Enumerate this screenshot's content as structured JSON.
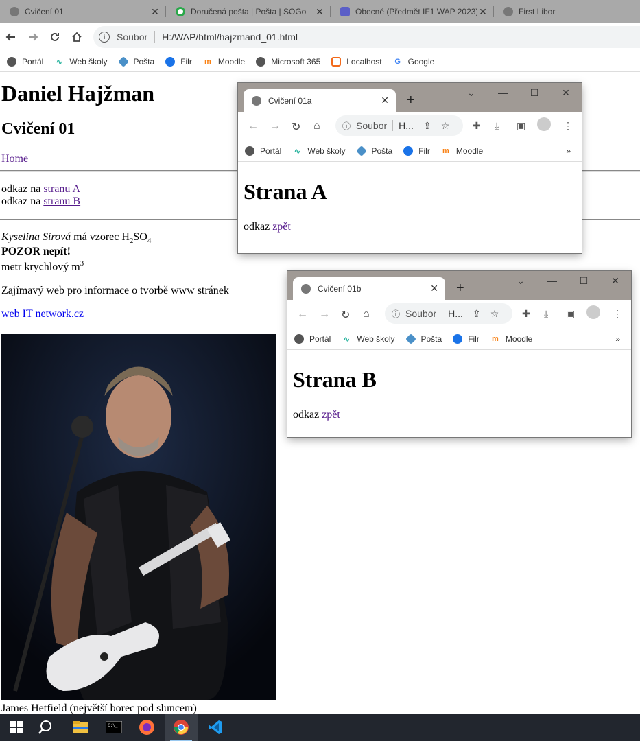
{
  "tabs": [
    {
      "label": "Cvičení 01",
      "icon": "globe-icon"
    },
    {
      "label": "Doručená pošta | Pošta | SOGo",
      "icon": "sogo-icon"
    },
    {
      "label": "Obecné (Předmět IF1 WAP 2023)",
      "icon": "teams-icon"
    },
    {
      "label": "First Libor",
      "icon": "globe-icon"
    }
  ],
  "toolbar": {
    "secure_label": "Soubor",
    "url": "H:/WAP/html/hajzmand_01.html"
  },
  "bookmarks": [
    {
      "label": "Portál",
      "icon": "globe-icon"
    },
    {
      "label": "Web školy",
      "icon": "school-icon"
    },
    {
      "label": "Pošta",
      "icon": "mail-icon"
    },
    {
      "label": "Filr",
      "icon": "filr-icon"
    },
    {
      "label": "Moodle",
      "icon": "moodle-icon"
    },
    {
      "label": "Microsoft 365",
      "icon": "globe-icon"
    },
    {
      "label": "Localhost",
      "icon": "xampp-icon"
    },
    {
      "label": "Google",
      "icon": "google-icon"
    }
  ],
  "page": {
    "title": "Daniel Hajžman",
    "subtitle": "Cvičení 01",
    "home_link": "Home",
    "odkaz_prefix": "odkaz na",
    "link_a": "stranu A",
    "link_b": "stranu B",
    "acid_name": "Kyselina Sírová",
    "acid_text": "má vzorec H",
    "sub2": "2",
    "so": "SO",
    "sub4": "4",
    "warning": "POZOR nepít!",
    "metric": "metr krychlový m",
    "sup3": "3",
    "info_text": "Zajímavý web pro informace o tvorbě www stránek",
    "web_link": "web IT network.cz",
    "caption": "James Hetfield (největší borec pod sluncem)"
  },
  "popup_a": {
    "tab_label": "Cvičení 01a",
    "secure_label": "Soubor",
    "url_short": "H...",
    "bookmarks": [
      "Portál",
      "Web školy",
      "Pošta",
      "Filr",
      "Moodle"
    ],
    "heading": "Strana A",
    "odkaz": "odkaz",
    "back": "zpět"
  },
  "popup_b": {
    "tab_label": "Cvičení 01b",
    "secure_label": "Soubor",
    "url_short": "H...",
    "bookmarks": [
      "Portál",
      "Web školy",
      "Pošta",
      "Filr",
      "Moodle"
    ],
    "heading": "Strana B",
    "odkaz": "odkaz",
    "back": "zpět"
  },
  "colors": {
    "link_visited": "#551a8b",
    "link": "#0000ee",
    "tabstrip": "#a9a9a9",
    "taskbar": "#22262e"
  }
}
